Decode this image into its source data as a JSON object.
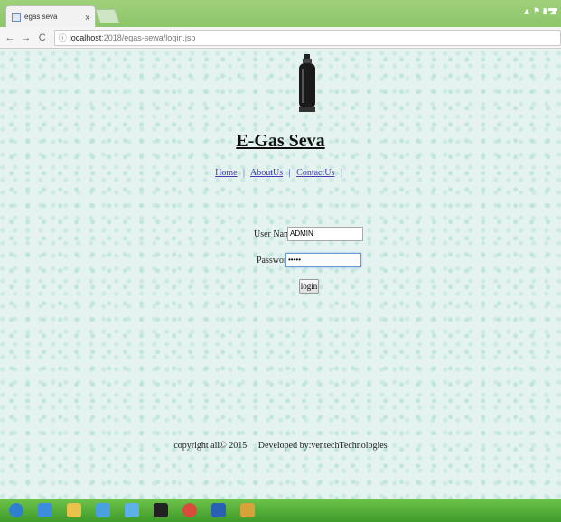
{
  "browser": {
    "tab_title": "egas seva",
    "tab_close": "x",
    "url_host": "localhost",
    "url_path": ":2018/egas-sewa/login.jsp",
    "back": "←",
    "forward": "→",
    "reload": "C"
  },
  "site": {
    "title": "E-Gas Seva",
    "nav": [
      {
        "label": "Home"
      },
      {
        "label": "AboutUs"
      },
      {
        "label": "ContactUs"
      }
    ],
    "separator": "|"
  },
  "login": {
    "username_label": "User Name:",
    "username_value": "ADMIN",
    "password_label": "Password:",
    "password_value": "•••••",
    "submit_label": "login"
  },
  "footer": {
    "text": "copyright all© 2015     Developed by:ventechTechnologies"
  },
  "taskbar": {
    "apps": [
      {
        "icon": "start-orb-icon",
        "color": "#2f7fd0"
      },
      {
        "icon": "internet-explorer-icon",
        "color": "#3c8de0"
      },
      {
        "icon": "file-explorer-icon",
        "color": "#e8c24a"
      },
      {
        "icon": "media-player-icon",
        "color": "#4aa0e0"
      },
      {
        "icon": "network-icon",
        "color": "#5fb0e8"
      },
      {
        "icon": "command-prompt-icon",
        "color": "#222222"
      },
      {
        "icon": "chrome-icon",
        "color": "#d94b3a"
      },
      {
        "icon": "word-icon",
        "color": "#2b5fb4"
      },
      {
        "icon": "paint-icon",
        "color": "#d8a23a"
      }
    ]
  }
}
